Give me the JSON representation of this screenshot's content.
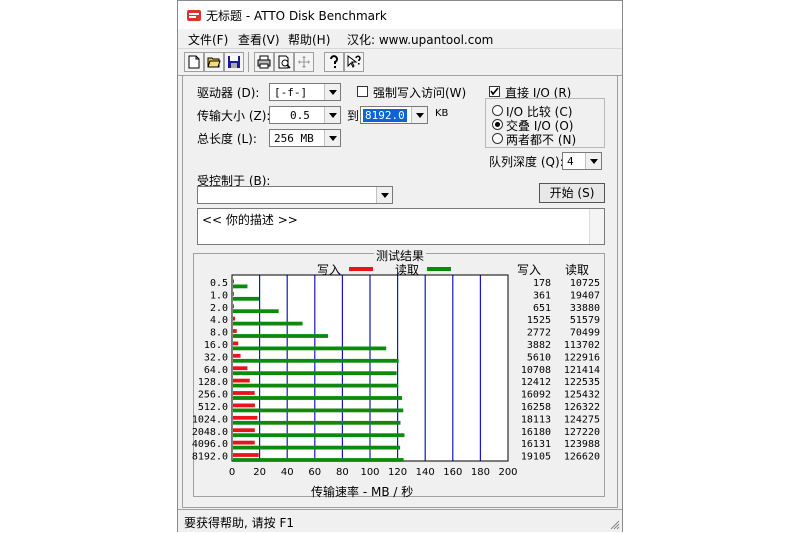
{
  "window": {
    "title": "无标题 - ATTO Disk Benchmark"
  },
  "menu": [
    "文件(F)",
    "查看(V)",
    "帮助(H)",
    "汉化: www.upantool.com"
  ],
  "toolbar": {
    "icons": [
      "new-icon",
      "open-icon",
      "save-icon",
      "print-icon",
      "print-preview-icon",
      "move-icon",
      "help-icon",
      "context-help-icon"
    ]
  },
  "settings": {
    "drive_label": "驱动器 (D):",
    "drive_value": "[-f-]",
    "force_write_label": "强制写入访问(W)",
    "force_write_checked": false,
    "transfer_size_label": "传输大小 (Z):",
    "transfer_from": "0.5",
    "to_label": "到",
    "transfer_to": "8192.0",
    "unit": "KB",
    "total_length_label": "总长度 (L):",
    "total_length": "256 MB",
    "direct_io_label": "直接 I/O (R)",
    "direct_io_checked": true,
    "radio_options": [
      "I/O 比较 (C)",
      "交叠 I/O (O)",
      "两者都不 (N)"
    ],
    "radio_selected": 1,
    "queue_depth_label": "队列深度 (Q):",
    "queue_depth": "4",
    "controlled_by_label": "受控制于 (B):",
    "controlled_by_value": "",
    "start_button": "开始 (S)",
    "description": "<<  你的描述  >>"
  },
  "results": {
    "title": "测试结果",
    "legend_write": "写入",
    "legend_read": "读取",
    "col_write": "写入",
    "col_read": "读取",
    "xlabel": "传输速率 - MB / 秒",
    "colors": {
      "write": "#e8131b",
      "read": "#0b8a0b",
      "grid": "#1515c9"
    }
  },
  "chart_data": {
    "type": "bar",
    "categories": [
      "0.5",
      "1.0",
      "2.0",
      "4.0",
      "8.0",
      "16.0",
      "32.0",
      "64.0",
      "128.0",
      "256.0",
      "512.0",
      "1024.0",
      "2048.0",
      "4096.0",
      "8192.0"
    ],
    "series": [
      {
        "name": "写入",
        "values": [
          178,
          361,
          651,
          1525,
          2772,
          3882,
          5610,
          10708,
          12412,
          16092,
          16258,
          18113,
          16180,
          16131,
          19105
        ]
      },
      {
        "name": "读取",
        "values": [
          10725,
          19407,
          33880,
          51579,
          70499,
          113702,
          122916,
          121414,
          122535,
          125432,
          126322,
          124275,
          127220,
          123988,
          126620
        ]
      }
    ],
    "xlabel": "传输速率 - MB / 秒",
    "ticks": [
      "0",
      "20",
      "40",
      "60",
      "80",
      "100",
      "120",
      "140",
      "160",
      "180",
      "200"
    ],
    "xlim": [
      0,
      200
    ],
    "grid": true,
    "legend": "top"
  },
  "statusbar": {
    "text": "要获得帮助, 请按 F1"
  }
}
